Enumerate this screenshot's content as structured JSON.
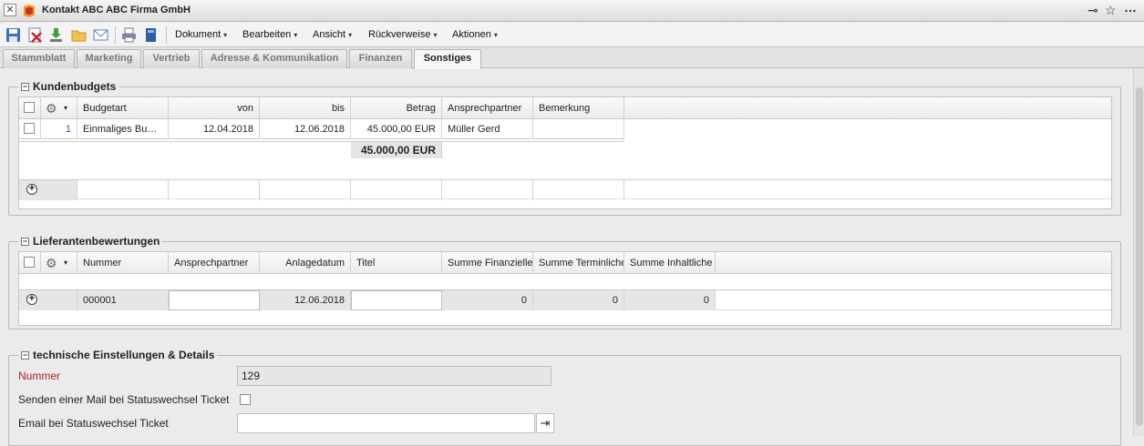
{
  "window": {
    "title": "Kontakt ABC ABC Firma GmbH",
    "close_glyph": "✕",
    "pin_glyph": "⊸",
    "star_glyph": "☆",
    "more_glyph": "…"
  },
  "toolbar": {
    "icons": [
      "save-icon",
      "delete-icon",
      "download-icon",
      "folder-icon",
      "mail-icon",
      "print-icon",
      "book-icon"
    ],
    "menus": [
      {
        "label": "Dokument"
      },
      {
        "label": "Bearbeiten"
      },
      {
        "label": "Ansicht"
      },
      {
        "label": "Rückverweise"
      },
      {
        "label": "Aktionen"
      }
    ],
    "caret": "▾"
  },
  "tabs": [
    {
      "label": "Stammblatt",
      "active": false
    },
    {
      "label": "Marketing",
      "active": false
    },
    {
      "label": "Vertrieb",
      "active": false
    },
    {
      "label": "Adresse & Kommunikation",
      "active": false
    },
    {
      "label": "Finanzen",
      "active": false
    },
    {
      "label": "Sonstiges",
      "active": true
    }
  ],
  "kundenbudgets": {
    "legend": "Kundenbudgets",
    "collapse_glyph": "−",
    "columns": [
      "Budgetart",
      "von",
      "bis",
      "Betrag",
      "Ansprechpartner",
      "Bemerkung"
    ],
    "rows": [
      {
        "nr": "1",
        "budgetart": "Einmaliges Bu…",
        "von": "12.04.2018",
        "bis": "12.06.2018",
        "betrag": "45.000,00 EUR",
        "ansprechpartner": "Müller Gerd",
        "bemerkung": ""
      }
    ],
    "total": "45.000,00 EUR",
    "add_glyph": "+"
  },
  "lieferantenbewertungen": {
    "legend": "Lieferantenbewertungen",
    "collapse_glyph": "−",
    "columns": [
      "Nummer",
      "Ansprechpartner",
      "Anlagedatum",
      "Titel",
      "Summe Finanzielle",
      "Summe Terminliche",
      "Summe Inhaltliche"
    ],
    "new_row": {
      "nummer": "000001",
      "ansprechpartner": "",
      "anlagedatum": "12.06.2018",
      "titel": "",
      "finanzielle": "0",
      "terminliche": "0",
      "inhaltliche": "0"
    },
    "add_glyph": "+"
  },
  "technisch": {
    "legend": "technische Einstellungen & Details",
    "collapse_glyph": "−",
    "nummer_label": "Nummer",
    "nummer_value": "129",
    "mail_label": "Senden einer Mail bei Statuswechsel Ticket",
    "email_label": "Email bei Statuswechsel Ticket",
    "email_value": "",
    "pick_glyph": "⇥"
  },
  "colors": {
    "accent_red": "#b02020",
    "link_blue": "#2255aa"
  }
}
